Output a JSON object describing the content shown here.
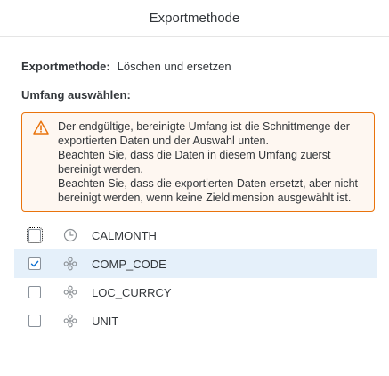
{
  "dialog": {
    "title": "Exportmethode"
  },
  "export_method": {
    "label": "Exportmethode:",
    "value": "Löschen und ersetzen"
  },
  "scope": {
    "label": "Umfang auswählen:"
  },
  "warning": {
    "icon": "warning-triangle-icon",
    "color": "#e9730c",
    "paragraph1": "Der endgültige, bereinigte Umfang ist die Schnittmenge der exportierten Daten und der Auswahl unten.",
    "paragraph2": "Beachten Sie, dass die Daten in diesem Umfang zuerst bereinigt werden.",
    "paragraph3": "Beachten Sie, dass die exportierten Daten ersetzt, aber nicht bereinigt werden, wenn keine Zieldimension ausgewählt ist."
  },
  "dimensions": [
    {
      "label": "CALMONTH",
      "icon": "clock-icon",
      "checked": false
    },
    {
      "label": "COMP_CODE",
      "icon": "dimension-icon",
      "checked": true
    },
    {
      "label": "LOC_CURRCY",
      "icon": "dimension-icon",
      "checked": false
    },
    {
      "label": "UNIT",
      "icon": "dimension-icon",
      "checked": false
    }
  ]
}
